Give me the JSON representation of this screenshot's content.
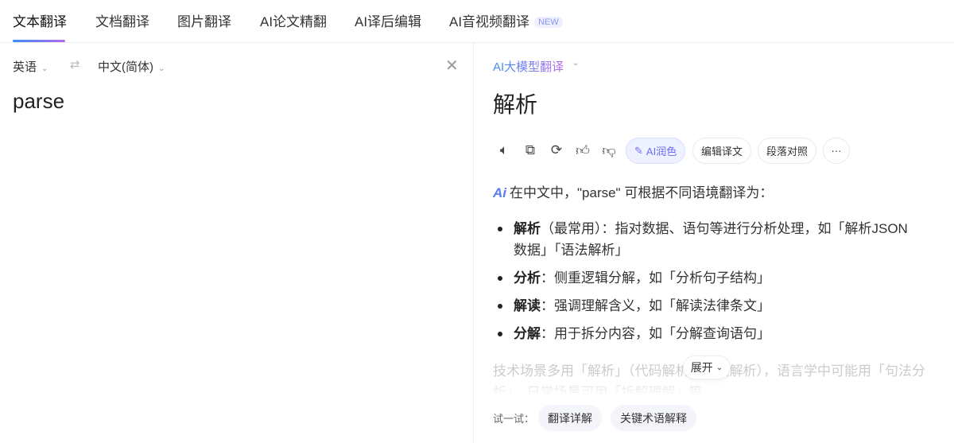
{
  "tabs": [
    {
      "label": "文本翻译"
    },
    {
      "label": "文档翻译"
    },
    {
      "label": "图片翻译"
    },
    {
      "label": "AI论文精翻"
    },
    {
      "label": "AI译后编辑"
    },
    {
      "label": "AI音视频翻译",
      "badge": "NEW"
    }
  ],
  "source": {
    "lang": "英语",
    "target_lang": "中文(简体)",
    "text": "parse"
  },
  "result": {
    "model": "AI大模型翻译",
    "translation": "解析",
    "actions": {
      "polish": "AI润色",
      "edit": "编辑译文",
      "compare": "段落对照",
      "more": "···"
    },
    "intro": "在中文中，\"parse\" 可根据不同语境翻译为：",
    "items": [
      {
        "term": "解析",
        "desc": "（最常用）：指对数据、语句等进行分析处理，如「解析JSON数据」「语法解析」"
      },
      {
        "term": "分析",
        "desc": "：侧重逻辑分解，如「分析句子结构」"
      },
      {
        "term": "解读",
        "desc": "：强调理解含义，如「解读法律条文」"
      },
      {
        "term": "分解",
        "desc": "：用于拆分内容，如「分解查询语句」"
      }
    ],
    "summary": "技术场景多用「解析」（代码解析、数据解析），语言学中可能用「句法分析」，日常场景可用「拆解理解」等。",
    "expand": "展开",
    "try_label": "试一试：",
    "try_chips": [
      "翻译详解",
      "关键术语解释"
    ]
  }
}
